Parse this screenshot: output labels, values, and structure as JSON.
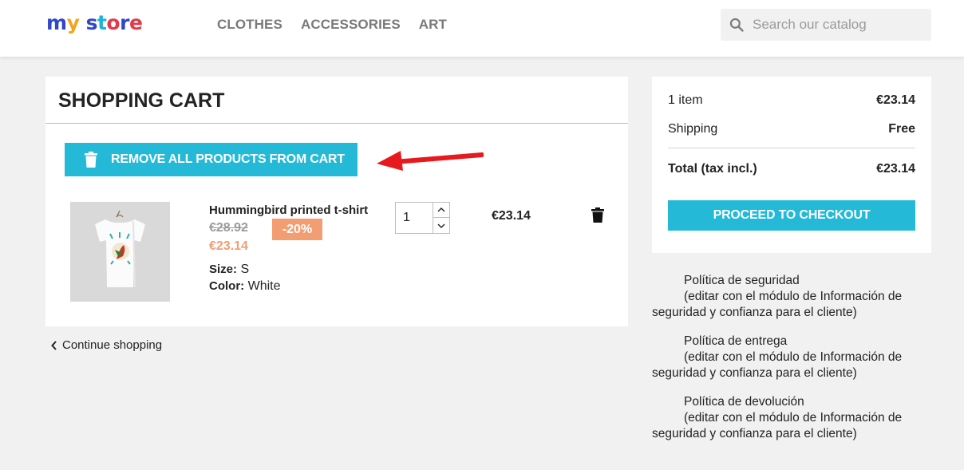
{
  "header": {
    "logo": {
      "letters": [
        "m",
        "y",
        " ",
        "s",
        "t",
        "o",
        "r",
        "e"
      ],
      "colors": [
        "#2f46c9",
        "#f2a61c",
        "#ffffff",
        "#2f46c9",
        "#1fb3d6",
        "#e23a48",
        "#2f46c9",
        "#e23a48"
      ]
    },
    "nav": [
      "CLOTHES",
      "ACCESSORIES",
      "ART"
    ],
    "search_placeholder": "Search our catalog"
  },
  "cart": {
    "title": "SHOPPING CART",
    "remove_all_label": "REMOVE ALL PRODUCTS FROM CART",
    "item": {
      "name": "Hummingbird printed t-shirt",
      "regular_price": "€28.92",
      "discount": "-20%",
      "price": "€23.14",
      "size_label": "Size:",
      "size_value": "S",
      "color_label": "Color:",
      "color_value": "White",
      "quantity": "1",
      "total": "€23.14"
    },
    "continue_label": "Continue shopping"
  },
  "summary": {
    "items_label": "1 item",
    "items_value": "€23.14",
    "shipping_label": "Shipping",
    "shipping_value": "Free",
    "total_label": "Total (tax incl.)",
    "total_value": "€23.14",
    "checkout_label": "PROCEED TO CHECKOUT"
  },
  "reassurance": [
    {
      "title": "Política de seguridad",
      "desc": "(editar con el módulo de Información de seguridad y confianza para el cliente)"
    },
    {
      "title": "Política de entrega",
      "desc": "(editar con el módulo de Información de seguridad y confianza para el cliente)"
    },
    {
      "title": "Política de devolución",
      "desc": "(editar con el módulo de Información de seguridad y confianza para el cliente)"
    }
  ],
  "colors": {
    "accent": "#24b9d7",
    "discount": "#f39d72",
    "annotation_arrow": "#e8191c"
  }
}
